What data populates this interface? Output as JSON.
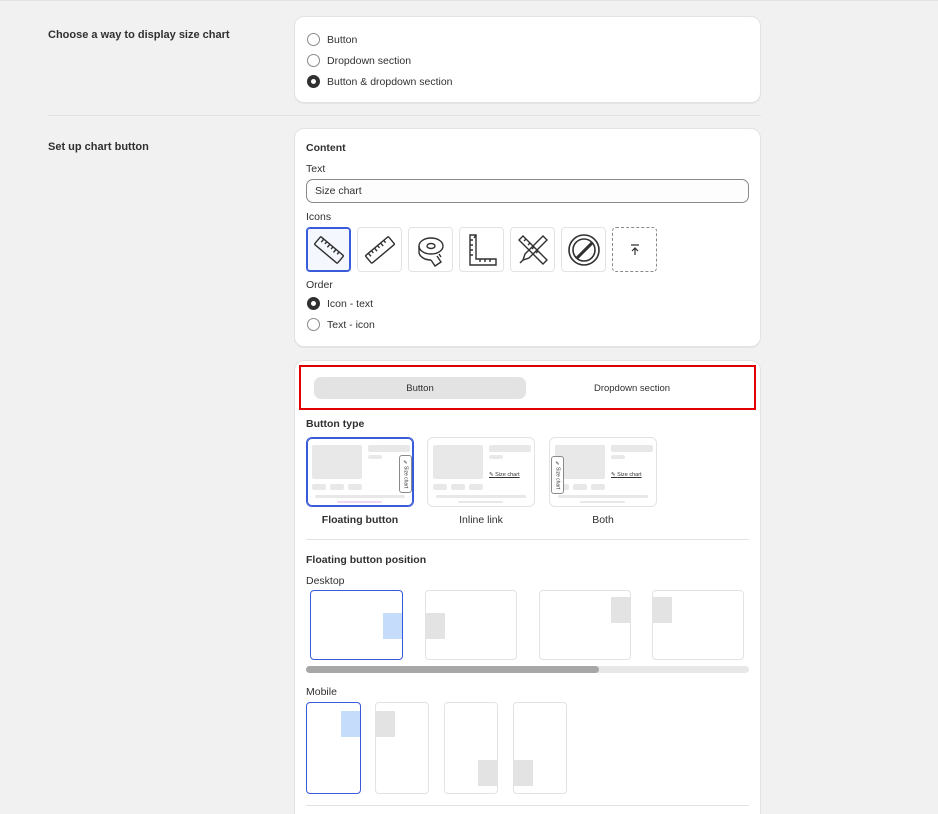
{
  "display": {
    "section_label": "Choose a way to display size chart",
    "options": [
      {
        "label": "Button",
        "checked": false
      },
      {
        "label": "Dropdown section",
        "checked": false
      },
      {
        "label": "Button & dropdown section",
        "checked": true
      }
    ]
  },
  "chart_button": {
    "section_label": "Set up chart button",
    "content_title": "Content",
    "text_label": "Text",
    "text_value": "Size chart",
    "icons_label": "Icons",
    "icons": [
      "ruler-diagonal-icon",
      "ruler-icon",
      "measuring-tape-icon",
      "set-square-icon",
      "ruler-pencil-icon",
      "prohibited-icon",
      "upload-icon"
    ],
    "order_label": "Order",
    "order_options": [
      {
        "label": "Icon - text",
        "checked": true
      },
      {
        "label": "Text - icon",
        "checked": false
      }
    ]
  },
  "tabs": {
    "items": [
      "Button",
      "Dropdown section"
    ],
    "active": "Button"
  },
  "button_type": {
    "title": "Button type",
    "options": [
      "Floating button",
      "Inline link",
      "Both"
    ],
    "selected": "Floating button",
    "preview_text": "Size chart"
  },
  "floating_position": {
    "title": "Floating button position",
    "desktop_label": "Desktop",
    "mobile_label": "Mobile"
  },
  "colors": {
    "selected_border": "#3a5bd9",
    "highlight": "#e00000",
    "preview_accent": "#c5dcfb"
  }
}
